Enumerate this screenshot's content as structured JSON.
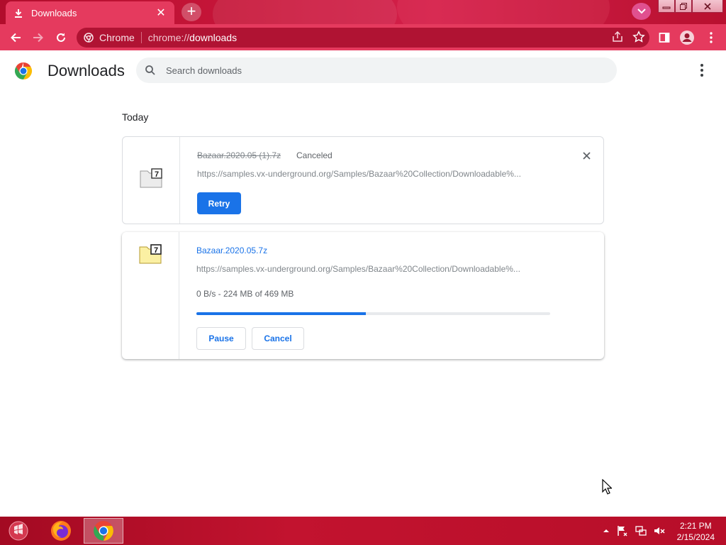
{
  "tab": {
    "title": "Downloads",
    "close": "✕",
    "new_tab": "+"
  },
  "omnibox": {
    "site_label": "Chrome",
    "url_scheme": "chrome://",
    "url_host": "downloads"
  },
  "page": {
    "title": "Downloads",
    "search": {
      "placeholder": "Search downloads",
      "value": ""
    },
    "section_date": "Today"
  },
  "downloads": [
    {
      "filename": "Bazaar.2020.05 (1).7z",
      "status": "Canceled",
      "url": "https://samples.vx-underground.org/Samples/Bazaar%20Collection/Downloadable%...",
      "action_label": "Retry",
      "state": "canceled"
    },
    {
      "filename": "Bazaar.2020.05.7z",
      "url": "https://samples.vx-underground.org/Samples/Bazaar%20Collection/Downloadable%...",
      "progress_text": "0 B/s - 224 MB of 469 MB",
      "progress_fraction": 0.478,
      "pause_label": "Pause",
      "cancel_label": "Cancel",
      "state": "in_progress"
    }
  ],
  "taskbar": {
    "apps": [
      "start-orb",
      "firefox",
      "chrome"
    ],
    "clock_time": "2:21 PM",
    "clock_date": "2/15/2024"
  },
  "colors": {
    "accent": "#1a73e8",
    "theme": "#e53a5e",
    "taskbar": "#b70e29"
  }
}
